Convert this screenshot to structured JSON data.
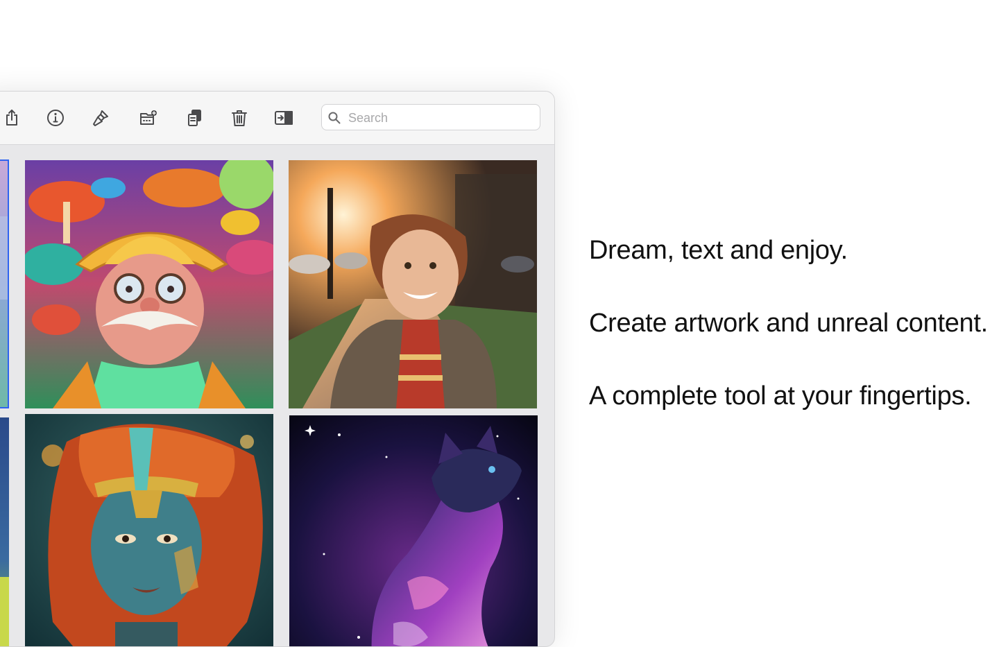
{
  "toolbar": {
    "buttons": [
      {
        "id": "share",
        "icon": "share-icon"
      },
      {
        "id": "info",
        "icon": "info-icon"
      },
      {
        "id": "brush",
        "icon": "brush-icon"
      },
      {
        "id": "move-to-folder",
        "icon": "folder-add-icon"
      },
      {
        "id": "duplicate",
        "icon": "duplicate-icon"
      },
      {
        "id": "delete",
        "icon": "trash-icon"
      },
      {
        "id": "sidebar",
        "icon": "sidebar-toggle-icon"
      }
    ],
    "search": {
      "placeholder": "Search",
      "value": "",
      "icon": "search-icon"
    }
  },
  "gallery": {
    "images": [
      {
        "id": "partial-left-top",
        "selected": true
      },
      {
        "id": "mushroom-man",
        "selected": false
      },
      {
        "id": "boy-sunset",
        "selected": false
      },
      {
        "id": "partial-left-bottom",
        "selected": false
      },
      {
        "id": "golden-headdress-woman",
        "selected": false
      },
      {
        "id": "cosmic-cat",
        "selected": false
      }
    ]
  },
  "taglines": [
    "Dream, text and enjoy.",
    "Create artwork and unreal content.",
    "A complete tool at your fingertips."
  ],
  "colors": {
    "accent": "#2f63f0",
    "icon": "#4a4a4c",
    "window_bg": "#e8e8ea"
  }
}
